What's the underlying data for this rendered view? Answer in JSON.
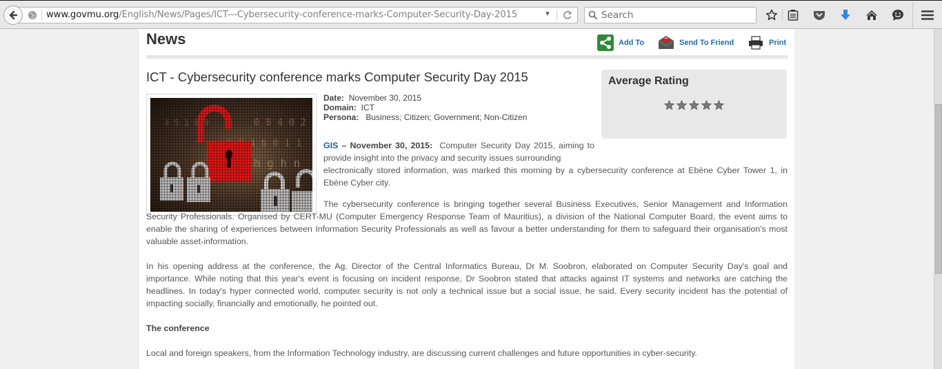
{
  "browser": {
    "url_host": "www.govmu.org",
    "url_path": "/English/News/Pages/ICT---Cybersecurity-conference-marks-Computer-Security-Day-2015",
    "search_placeholder": "Search",
    "toolbar_icons": [
      "back-icon",
      "globe-icon",
      "dropdown-icon",
      "reload-icon",
      "search-icon",
      "bookmark-star-icon",
      "reading-list-icon",
      "pocket-icon",
      "downloads-icon",
      "home-icon",
      "chat-icon",
      "menu-icon"
    ],
    "accent_download": "#2f86e0"
  },
  "page": {
    "section_title": "News",
    "actions": {
      "add_to": "Add To",
      "send_to_friend": "Send To Friend",
      "print": "Print"
    },
    "article_title": "ICT - Cybersecurity conference marks Computer Security Day 2015",
    "rating": {
      "title": "Average Rating",
      "stars_total": 5,
      "stars_filled": 0
    },
    "meta": {
      "date_label": "Date:",
      "date_value": "November 30, 2015",
      "domain_label": "Domain:",
      "domain_value": "ICT",
      "persona_label": "Persona:",
      "persona_value": "Business; Citizen; Government; Non-Citizen"
    },
    "image_alt": "Red open padlock among grey padlocks on digital background",
    "body": {
      "p1_source": "GIS",
      "p1_dateline": " – November 30, 2015:",
      "p1_narrow": "Computer Security Day 2015, aiming to provide insight into the privacy and security issues surrounding",
      "p1_rest": "electronically stored information, was marked this morning by a cybersecurity conference at Ebène Cyber Tower 1, in Ebène Cyber city.",
      "p2": "The cybersecurity conference is bringing together several Business Executives, Senior Management and Information Security Professionals.  Organised by CERT-MU (Computer Emergency Response Team of Mauritius), a division of the National Computer Board, the event aims to enable the sharing of experiences between Information Security Professionals as well as favour a better understanding for them to safeguard their organisation's most valuable asset-information.",
      "p3": "In his opening address at the conference, the Ag. Director of the Central Informatics Bureau, Dr M. Soobron, elaborated on Computer Security Day's goal and importance.  While noting that this year's event is focusing on incident response, Dr Soobron stated that attacks against IT systems and networks are catching the headlines.  In today's hyper connected world, computer security is not only a technical issue but a social issue, he said.  Every security incident has the potential of impacting socially, financially and emotionally, he pointed out.",
      "p4_heading": "The conference",
      "p5": "Local and foreign speakers, from the Information Technology industry, are discussing current challenges and future opportunities in cyber-security."
    }
  }
}
